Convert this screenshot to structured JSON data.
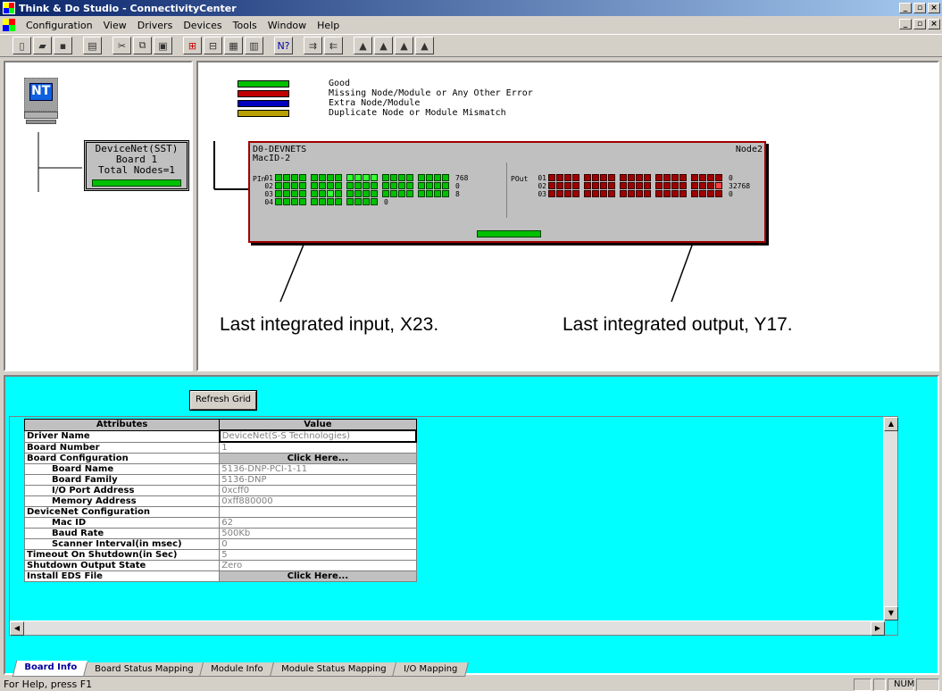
{
  "window": {
    "title": "Think & Do Studio - ConnectivityCenter"
  },
  "menu": [
    "Configuration",
    "View",
    "Drivers",
    "Devices",
    "Tools",
    "Window",
    "Help"
  ],
  "toolbar_icons": [
    "new-icon",
    "open-icon",
    "save-icon",
    "print-icon",
    "cut-icon",
    "copy-icon",
    "paste-icon",
    "add-icon",
    "remove-icon",
    "grid-icon",
    "doc-icon",
    "help-icon",
    "map-in-icon",
    "map-out-icon",
    "io-icon",
    "io2-icon",
    "io3-icon",
    "io4-icon"
  ],
  "tree": {
    "nt_label": "NT",
    "board_line1": "DeviceNet(SST)",
    "board_line2": "Board 1",
    "board_line3": "Total Nodes=1"
  },
  "legend": [
    {
      "label": "Good",
      "color": "#00c000"
    },
    {
      "label": "Missing Node/Module or Any Other Error",
      "color": "#c00000"
    },
    {
      "label": "Extra Node/Module",
      "color": "#0000c0"
    },
    {
      "label": "Duplicate Node or Module Mismatch",
      "color": "#b8a000"
    }
  ],
  "node": {
    "name": "D0-DEVNETS",
    "macid": "MacID-2",
    "node_label": "Node2",
    "pin_label": "PIn",
    "pout_label": "POut",
    "in_rows": [
      {
        "row": "01",
        "end": "768"
      },
      {
        "row": "02",
        "end": "0"
      },
      {
        "row": "03",
        "end": "8"
      },
      {
        "row": "04",
        "end": "0"
      }
    ],
    "out_rows": [
      {
        "row": "01",
        "end": "0"
      },
      {
        "row": "02",
        "end": "32768"
      },
      {
        "row": "03",
        "end": "0"
      }
    ],
    "colors": {
      "good": "#00c000",
      "good_bright": "#33ff33",
      "bad": "#a00000",
      "bad_bright": "#ff4040"
    }
  },
  "annotations": {
    "input": "Last integrated input, X23.",
    "output": "Last integrated output, Y17."
  },
  "refresh_label": "Refresh Grid",
  "grid": {
    "headers": [
      "Attributes",
      "Value"
    ],
    "rows": [
      {
        "attr": "Driver Name",
        "value": "DeviceNet(S-S Technologies)",
        "indent": false,
        "click": false
      },
      {
        "attr": "Board Number",
        "value": "1",
        "indent": false,
        "click": false
      },
      {
        "attr": "Board Configuration",
        "value": "Click Here...",
        "indent": false,
        "click": true
      },
      {
        "attr": "Board Name",
        "value": "5136-DNP-PCI-1-11",
        "indent": true,
        "click": false
      },
      {
        "attr": "Board Family",
        "value": "5136-DNP",
        "indent": true,
        "click": false
      },
      {
        "attr": "I/O Port Address",
        "value": "0xcff0",
        "indent": true,
        "click": false
      },
      {
        "attr": "Memory Address",
        "value": "0xff880000",
        "indent": true,
        "click": false
      },
      {
        "attr": "DeviceNet Configuration",
        "value": "",
        "indent": false,
        "click": false
      },
      {
        "attr": "Mac ID",
        "value": "62",
        "indent": true,
        "click": false
      },
      {
        "attr": "Baud Rate",
        "value": "500Kb",
        "indent": true,
        "click": false
      },
      {
        "attr": "Scanner Interval(in msec)",
        "value": "0",
        "indent": true,
        "click": false
      },
      {
        "attr": "Timeout On Shutdown(in Sec)",
        "value": "5",
        "indent": false,
        "click": false
      },
      {
        "attr": "Shutdown Output State",
        "value": "Zero",
        "indent": false,
        "click": false
      },
      {
        "attr": "Install EDS File",
        "value": "Click Here...",
        "indent": false,
        "click": true
      }
    ]
  },
  "tabs": [
    "Board Info",
    "Board Status Mapping",
    "Module Info",
    "Module Status Mapping",
    "I/O Mapping"
  ],
  "status": {
    "help": "For Help, press F1",
    "num": "NUM"
  }
}
